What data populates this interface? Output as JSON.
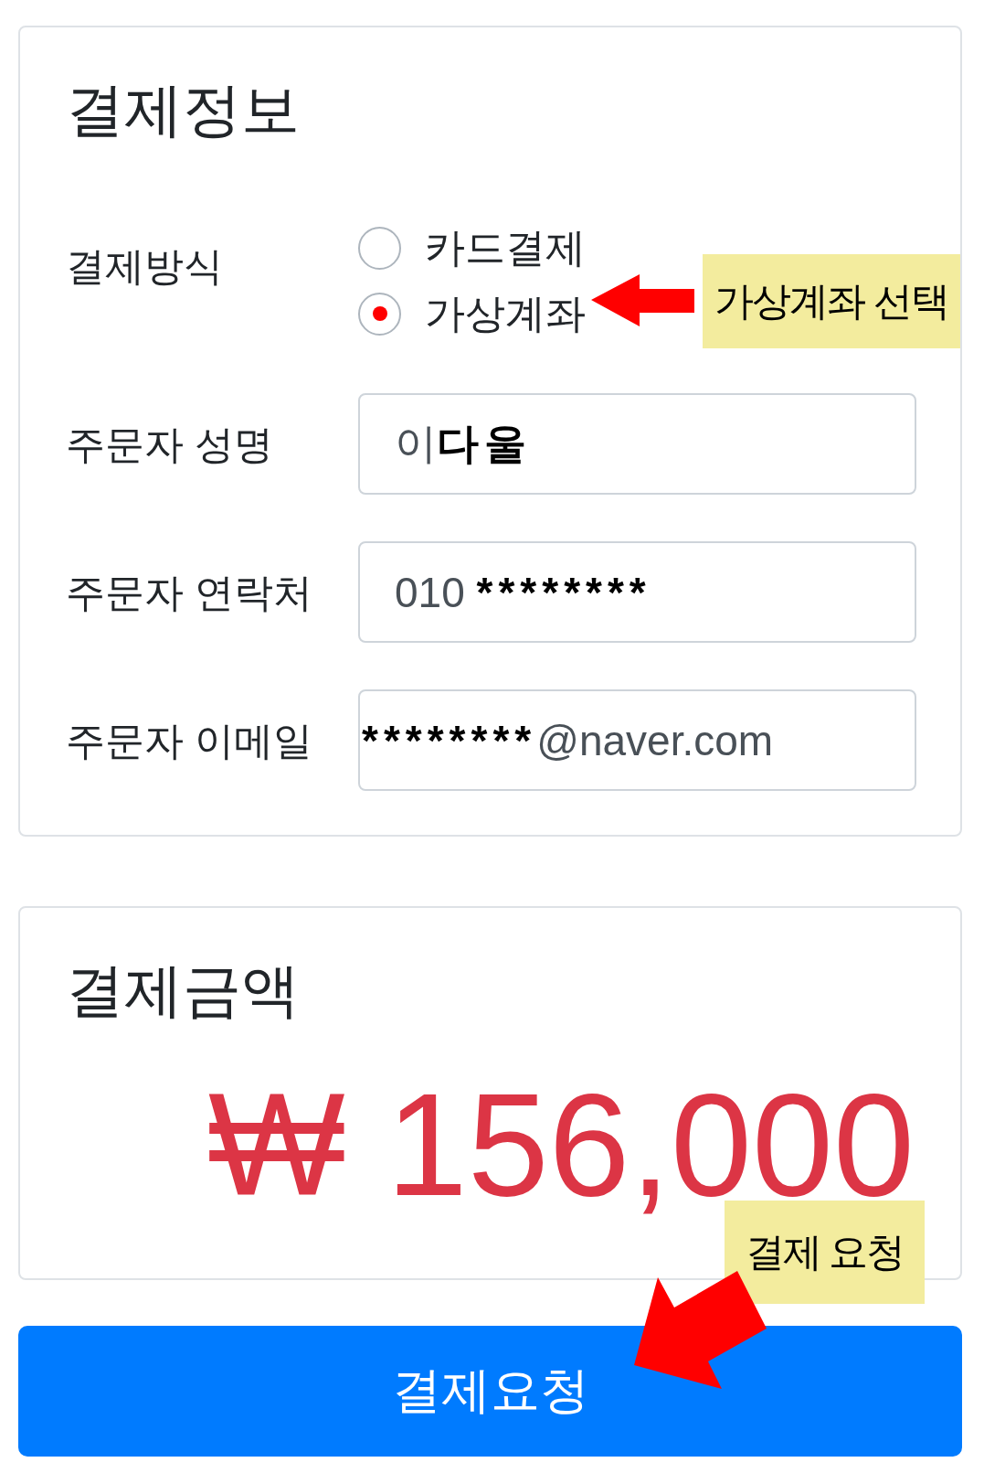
{
  "payment_info": {
    "title": "결제정보",
    "method": {
      "label": "결제방식",
      "options": [
        {
          "label": "카드결제",
          "selected": false
        },
        {
          "label": "가상계좌",
          "selected": true
        }
      ]
    },
    "fields": [
      {
        "label": "주문자 성명",
        "value": [
          {
            "text": "이",
            "kind": "typed"
          },
          {
            "text": "다울",
            "kind": "overlaid"
          }
        ]
      },
      {
        "label": "주문자 연락처",
        "value": [
          {
            "text": "010 ",
            "kind": "typed"
          },
          {
            "text": "********",
            "kind": "overlaid"
          }
        ]
      },
      {
        "label": "주문자 이메일",
        "value": [
          {
            "text": "********",
            "kind": "overlaid"
          },
          {
            "text": "@naver.com",
            "kind": "typed"
          }
        ]
      }
    ]
  },
  "payment_amount": {
    "title": "결제금액",
    "amount": "₩ 156,000"
  },
  "submit_button": {
    "label": "결제요청"
  },
  "annotations": [
    {
      "kind": "left-arrow",
      "text": "가상계좌 선택"
    },
    {
      "kind": "down-left-arrow",
      "text": "결제 요청"
    }
  ]
}
